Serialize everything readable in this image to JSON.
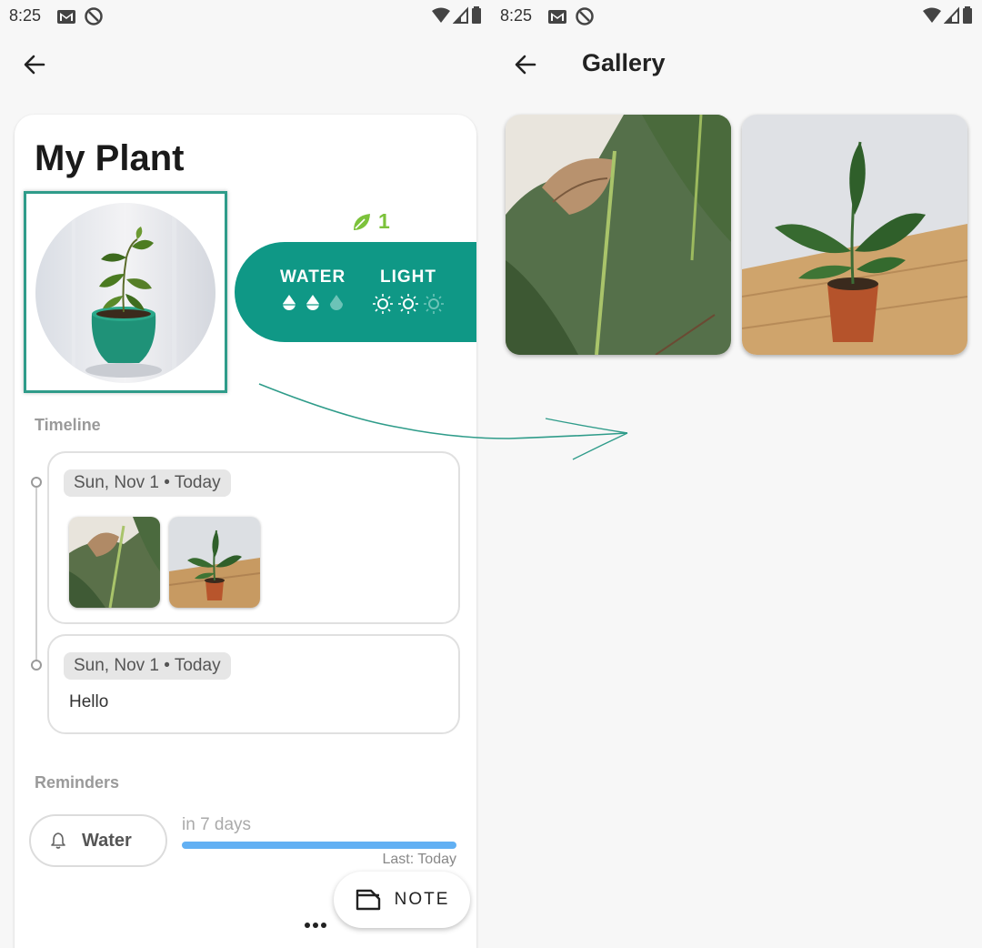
{
  "left_screen": {
    "status_bar": {
      "time": "8:25",
      "icons": [
        "gmail-icon",
        "do-not-disturb-icon"
      ],
      "right_icons": [
        "wifi-icon",
        "signal-icon",
        "battery-icon"
      ]
    },
    "appbar": {
      "back_icon": "arrow-back-icon"
    },
    "plant": {
      "name": "My Plant",
      "leaf_count": "1",
      "care": {
        "water": {
          "label": "WATER",
          "level": 2,
          "max": 3
        },
        "light": {
          "label": "LIGHT",
          "level": 2,
          "max": 3
        }
      }
    },
    "timeline": {
      "label": "Timeline",
      "entries": [
        {
          "date": "Sun, Nov 1 • Today",
          "type": "photos",
          "photo_count": 2
        },
        {
          "date": "Sun, Nov 1 • Today",
          "type": "note",
          "text": "Hello"
        }
      ]
    },
    "reminders": {
      "label": "Reminders",
      "items": [
        {
          "label": "Water",
          "when": "in 7 days",
          "progress": 1.0,
          "last": "Last: Today"
        }
      ]
    },
    "fab": {
      "label": "NOTE"
    }
  },
  "right_screen": {
    "status_bar": {
      "time": "8:25"
    },
    "appbar": {
      "title": "Gallery",
      "back_icon": "arrow-back-icon"
    },
    "gallery": {
      "photo_count": 2
    }
  },
  "colors": {
    "accent_teal": "#0f9886",
    "frame_teal": "#2f9c8a",
    "leaf_green": "#7cc23b",
    "progress_blue": "#62b0f3"
  }
}
